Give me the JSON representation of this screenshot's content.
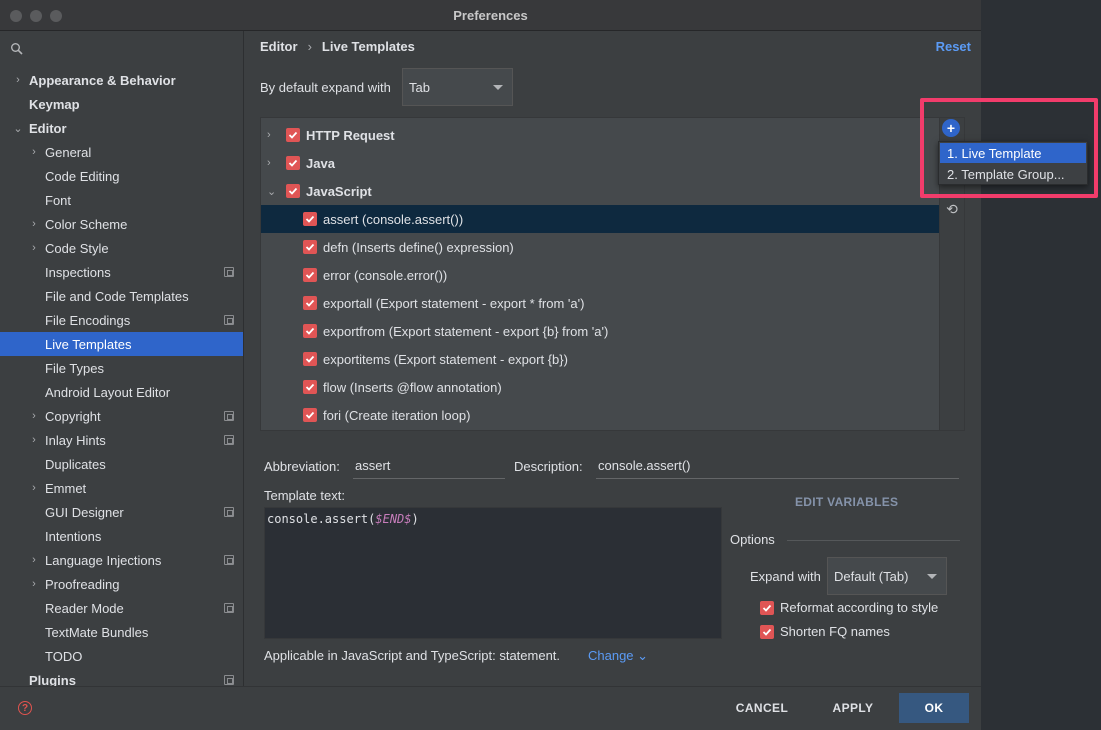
{
  "window": {
    "title": "Preferences"
  },
  "sidebar": {
    "items": [
      {
        "label": "Appearance & Behavior",
        "level": 0,
        "chevron": true,
        "bold": true
      },
      {
        "label": "Keymap",
        "level": 0,
        "chevron": false,
        "bold": true
      },
      {
        "label": "Editor",
        "level": 0,
        "chevron": "down",
        "bold": true
      },
      {
        "label": "General",
        "level": 1,
        "chevron": true
      },
      {
        "label": "Code Editing",
        "level": 1
      },
      {
        "label": "Font",
        "level": 1
      },
      {
        "label": "Color Scheme",
        "level": 1,
        "chevron": true
      },
      {
        "label": "Code Style",
        "level": 1,
        "chevron": true
      },
      {
        "label": "Inspections",
        "level": 1,
        "project": true
      },
      {
        "label": "File and Code Templates",
        "level": 1
      },
      {
        "label": "File Encodings",
        "level": 1,
        "project": true
      },
      {
        "label": "Live Templates",
        "level": 1,
        "selected": true
      },
      {
        "label": "File Types",
        "level": 1
      },
      {
        "label": "Android Layout Editor",
        "level": 1
      },
      {
        "label": "Copyright",
        "level": 1,
        "chevron": true,
        "project": true
      },
      {
        "label": "Inlay Hints",
        "level": 1,
        "chevron": true,
        "project": true
      },
      {
        "label": "Duplicates",
        "level": 1
      },
      {
        "label": "Emmet",
        "level": 1,
        "chevron": true
      },
      {
        "label": "GUI Designer",
        "level": 1,
        "project": true
      },
      {
        "label": "Intentions",
        "level": 1
      },
      {
        "label": "Language Injections",
        "level": 1,
        "chevron": true,
        "project": true
      },
      {
        "label": "Proofreading",
        "level": 1,
        "chevron": true
      },
      {
        "label": "Reader Mode",
        "level": 1,
        "project": true
      },
      {
        "label": "TextMate Bundles",
        "level": 1
      },
      {
        "label": "TODO",
        "level": 1
      },
      {
        "label": "Plugins",
        "level": 0,
        "bold": true,
        "project": true
      }
    ]
  },
  "header": {
    "breadcrumb": [
      "Editor",
      "Live Templates"
    ],
    "breadcrumb_sep": "›",
    "reset": "Reset"
  },
  "expand_default": {
    "label": "By default expand with",
    "value": "Tab"
  },
  "templates": [
    {
      "text": "HTTP Request",
      "group": true,
      "chevron": "›"
    },
    {
      "text": "Java",
      "group": true,
      "chevron": "›"
    },
    {
      "text": "JavaScript",
      "group": true,
      "chevron": "⌄"
    },
    {
      "text": "assert (console.assert())",
      "selected": true
    },
    {
      "text": "defn (Inserts define() expression)"
    },
    {
      "text": "error (console.error())"
    },
    {
      "text": "exportall (Export statement - export * from 'a')"
    },
    {
      "text": "exportfrom (Export statement - export {b} from 'a')"
    },
    {
      "text": "exportitems (Export statement - export {b})"
    },
    {
      "text": "flow (Inserts @flow annotation)"
    },
    {
      "text": "fori (Create iteration loop)"
    }
  ],
  "popup": {
    "items": [
      "1. Live Template",
      "2. Template Group..."
    ]
  },
  "form": {
    "abbreviation_label": "Abbreviation:",
    "abbreviation_value": "assert",
    "description_label": "Description:",
    "description_value": "console.assert()",
    "template_text_label": "Template text:",
    "template_code": "console.assert(",
    "template_var": "$END$",
    "template_close": ")",
    "edit_variables": "EDIT VARIABLES"
  },
  "options": {
    "title": "Options",
    "expand_with_label": "Expand with",
    "expand_with_value": "Default (Tab)",
    "reformat": "Reformat according to style",
    "shorten": "Shorten FQ names"
  },
  "applicable": {
    "text": "Applicable in JavaScript and TypeScript: statement.",
    "change": "Change ⌄"
  },
  "footer": {
    "cancel": "CANCEL",
    "apply": "APPLY",
    "ok": "OK",
    "help": "?"
  },
  "colors": {
    "accent": "#2f65ca",
    "checkbox": "#e05555",
    "highlight": "#f23c6b",
    "link": "#5b9bf5"
  }
}
